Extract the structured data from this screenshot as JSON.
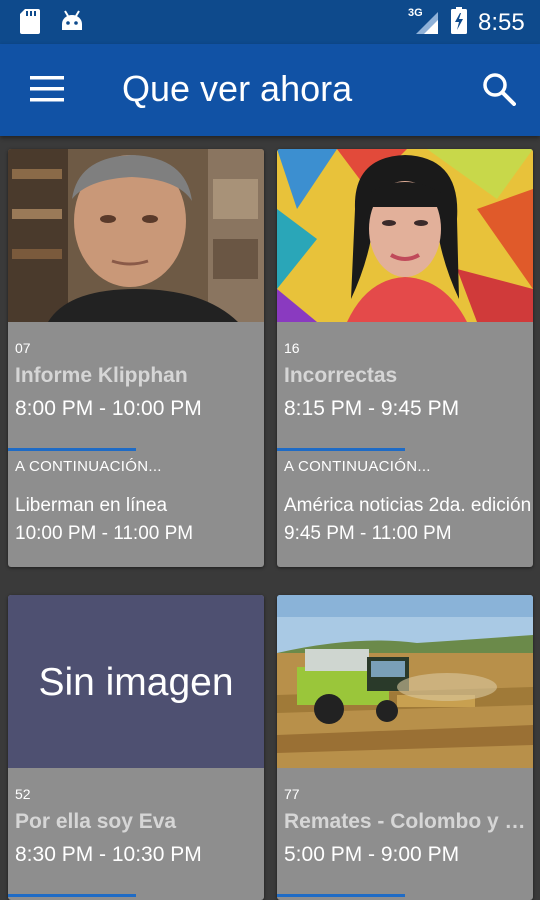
{
  "status_bar": {
    "network": "3G",
    "time": "8:55"
  },
  "app_bar": {
    "title": "Que ver ahora",
    "menu_icon": "hamburger-menu-icon",
    "search_icon": "search-icon"
  },
  "programs": [
    {
      "channel": "07",
      "title": "Informe Klipphan",
      "time": "8:00 PM - 10:00 PM",
      "progress": 0.5,
      "next_label": "A CONTINUACIÓN...",
      "next_title": "Liberman en línea",
      "next_time": "10:00 PM - 11:00 PM"
    },
    {
      "channel": "16",
      "title": "Incorrectas",
      "time": "8:15 PM - 9:45 PM",
      "progress": 0.5,
      "next_label": "A CONTINUACIÓN...",
      "next_title": "América noticias 2da. edición",
      "next_time": "9:45 PM - 11:00 PM"
    },
    {
      "channel": "52",
      "title": "Por ella soy Eva",
      "time": "8:30 PM - 10:30 PM",
      "progress": 0.5,
      "placeholder_text": "Sin imagen"
    },
    {
      "channel": "77",
      "title": "Remates - Colombo y Magliano",
      "time": "5:00 PM - 9:00 PM",
      "progress": 0.5
    }
  ],
  "colors": {
    "status_bar": "#0e4a8c",
    "app_bar": "#1152a5",
    "background": "#3a3a3a",
    "card": "#8e8e8e",
    "progress": "#1e6bc6"
  }
}
